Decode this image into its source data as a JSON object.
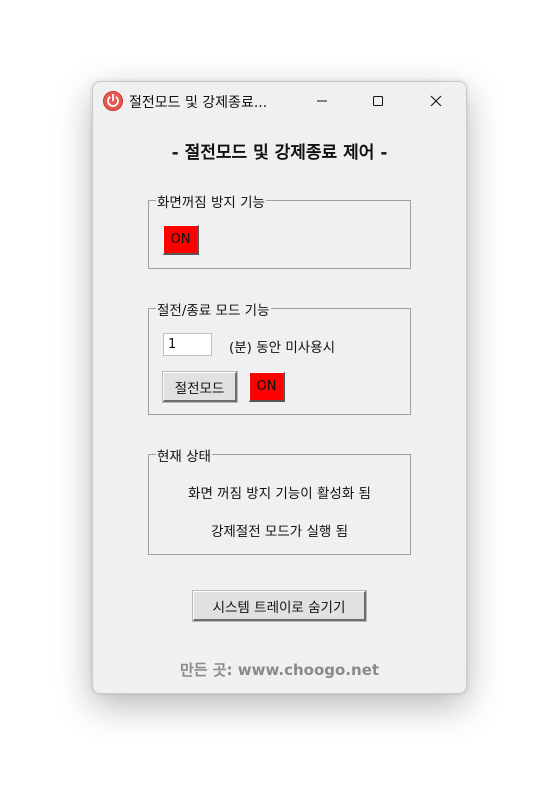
{
  "window": {
    "title": "절전모드 및 강제종료...",
    "icon": "power-icon"
  },
  "heading": "- 절전모드 및 강제종료 제어 -",
  "screen_keepalive": {
    "group_label": "화면꺼짐 방지 기능",
    "toggle_label": "ON",
    "toggle_color": "#ff0000"
  },
  "sleep_shutdown": {
    "group_label": "절전/종료 모드 기능",
    "minutes_value": "1",
    "minutes_suffix": "(분) 동안 미사용시",
    "mode_button_label": "절전모드",
    "toggle_label": "ON",
    "toggle_color": "#ff0000"
  },
  "status": {
    "group_label": "현재 상태",
    "line1": "화면 꺼짐 방지 기능이 활성화 됨",
    "line2": "강제절전 모드가 실행 됨"
  },
  "tray_button_label": "시스템 트레이로 숨기기",
  "credit": "만든 곳: www.choogo.net"
}
